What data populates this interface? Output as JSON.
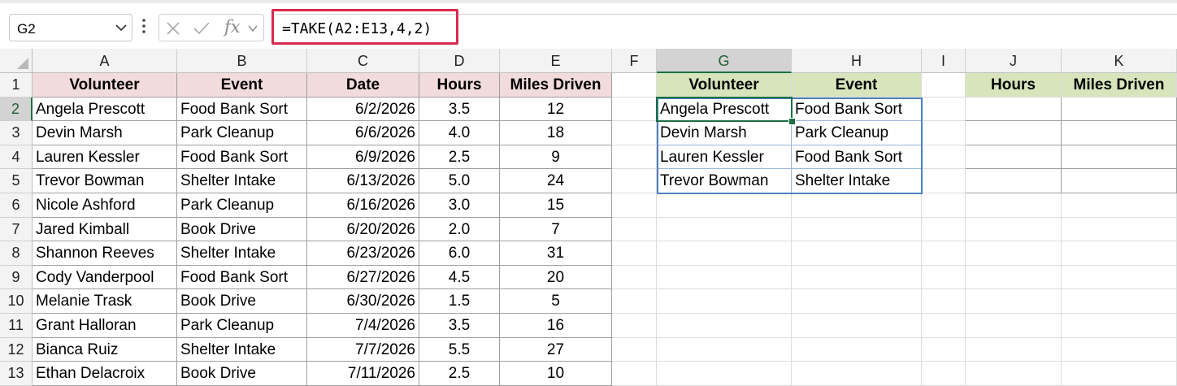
{
  "formula_bar": {
    "name_box": "G2",
    "fx_label": "fx",
    "formula": "=TAKE(A2:E13,4,2)"
  },
  "columns": [
    "A",
    "B",
    "C",
    "D",
    "E",
    "F",
    "G",
    "H",
    "I",
    "J",
    "K"
  ],
  "selected_column": "G",
  "selected_row": "2",
  "row_numbers": [
    "1",
    "2",
    "3",
    "4",
    "5",
    "6",
    "7",
    "8",
    "9",
    "10",
    "11",
    "12",
    "13"
  ],
  "source_table": {
    "headers": [
      "Volunteer",
      "Event",
      "Date",
      "Hours",
      "Miles Driven"
    ],
    "rows": [
      [
        "Angela Prescott",
        "Food Bank Sort",
        "6/2/2026",
        "3.5",
        "12"
      ],
      [
        "Devin Marsh",
        "Park Cleanup",
        "6/6/2026",
        "4.0",
        "18"
      ],
      [
        "Lauren Kessler",
        "Food Bank Sort",
        "6/9/2026",
        "2.5",
        "9"
      ],
      [
        "Trevor Bowman",
        "Shelter Intake",
        "6/13/2026",
        "5.0",
        "24"
      ],
      [
        "Nicole Ashford",
        "Park Cleanup",
        "6/16/2026",
        "3.0",
        "15"
      ],
      [
        "Jared Kimball",
        "Book Drive",
        "6/20/2026",
        "2.0",
        "7"
      ],
      [
        "Shannon Reeves",
        "Shelter Intake",
        "6/23/2026",
        "6.0",
        "31"
      ],
      [
        "Cody Vanderpool",
        "Food Bank Sort",
        "6/27/2026",
        "4.5",
        "20"
      ],
      [
        "Melanie Trask",
        "Book Drive",
        "6/30/2026",
        "1.5",
        "5"
      ],
      [
        "Grant Halloran",
        "Park Cleanup",
        "7/4/2026",
        "3.5",
        "16"
      ],
      [
        "Bianca Ruiz",
        "Shelter Intake",
        "7/7/2026",
        "5.5",
        "27"
      ],
      [
        "Ethan Delacroix",
        "Book Drive",
        "7/11/2026",
        "2.5",
        "10"
      ]
    ]
  },
  "result_table": {
    "headers": [
      "Volunteer",
      "Event"
    ],
    "rows": [
      [
        "Angela Prescott",
        "Food Bank Sort"
      ],
      [
        "Devin Marsh",
        "Park Cleanup"
      ],
      [
        "Lauren Kessler",
        "Food Bank Sort"
      ],
      [
        "Trevor Bowman",
        "Shelter Intake"
      ]
    ]
  },
  "second_table": {
    "headers": [
      "Hours",
      "Miles Driven"
    ],
    "rows": [
      [
        "",
        ""
      ],
      [
        "",
        ""
      ],
      [
        "",
        ""
      ],
      [
        "",
        ""
      ]
    ]
  },
  "colors": {
    "source_header_fill": "#f2dcdb",
    "result_header_fill": "#d8e4bc",
    "formula_highlight": "#d8294f",
    "active_cell": "#1d7044",
    "spill_border": "#4f7fc0"
  },
  "icons": {
    "name_box_dropdown": "chevron-down-icon",
    "cancel": "close-icon",
    "enter": "check-icon",
    "select_all": "select-all-triangle-icon"
  }
}
